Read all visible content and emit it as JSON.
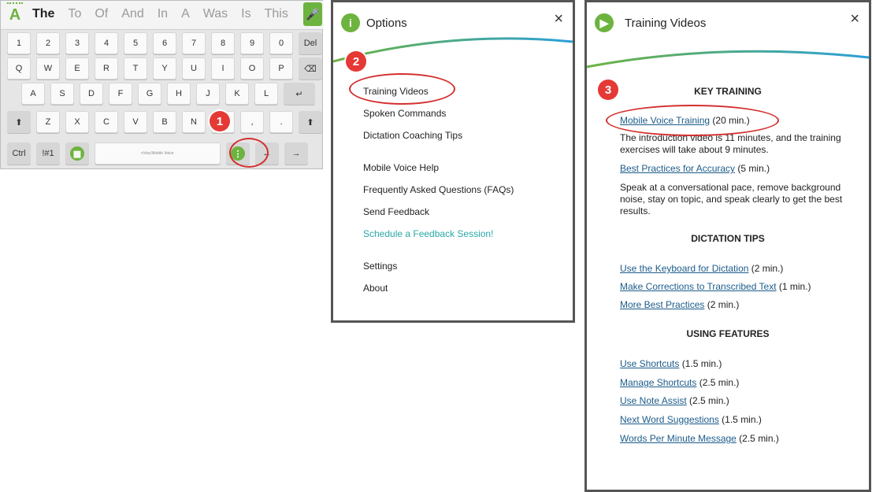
{
  "keyboard": {
    "suggestions": [
      "The",
      "To",
      "Of",
      "And",
      "In",
      "A",
      "Was",
      "Is",
      "This"
    ],
    "numbers": [
      "1",
      "2",
      "3",
      "4",
      "5",
      "6",
      "7",
      "8",
      "9",
      "0",
      "Del"
    ],
    "row_q": [
      "Q",
      "W",
      "E",
      "R",
      "T",
      "Y",
      "U",
      "I",
      "O",
      "P"
    ],
    "row_a": [
      "A",
      "S",
      "D",
      "F",
      "G",
      "H",
      "J",
      "K",
      "L"
    ],
    "row_z": [
      "Z",
      "X",
      "C",
      "V",
      "B",
      "N"
    ],
    "ctrl": "Ctrl",
    "sym": "!#1",
    "space_label": "nVoq Mobile Voice"
  },
  "options": {
    "title": "Options",
    "items": [
      "Training Videos",
      "Spoken Commands",
      "Dictation Coaching Tips"
    ],
    "items2": [
      "Mobile Voice Help",
      "Frequently Asked Questions (FAQs)",
      "Send Feedback"
    ],
    "schedule": "Schedule a Feedback Session!",
    "items3": [
      "Settings",
      "About"
    ]
  },
  "training": {
    "title": "Training Videos",
    "sec1": "KEY TRAINING",
    "mvt_link": "Mobile Voice Training",
    "mvt_time": " (20 min.)",
    "mvt_desc": "The introduction video is 11 minutes, and the training exercises will take about 9 minutes.",
    "bpa_link": "Best Practices for Accuracy",
    "bpa_time": " (5 min.)",
    "bpa_desc": "Speak at a conversational pace, remove background noise, stay on topic, and speak clearly to get the best results.",
    "sec2": "DICTATION TIPS",
    "d1_link": "Use the Keyboard for Dictation",
    "d1_time": " (2 min.)",
    "d2_link": "Make Corrections to Transcribed Text",
    "d2_time": " (1 min.)",
    "d3_link": "More Best Practices",
    "d3_time": " (2 min.)",
    "sec3": "USING FEATURES",
    "f1_link": "Use Shortcuts",
    "f1_time": " (1.5 min.)",
    "f2_link": "Manage Shortcuts",
    "f2_time": " (2.5 min.)",
    "f3_link": "Use Note Assist",
    "f3_time": " (2.5 min.)",
    "f4_link": "Next Word Suggestions",
    "f4_time": " (1.5 min.)",
    "f5_link": "Words Per Minute Message",
    "f5_time": " (2.5 min.)"
  },
  "badges": [
    "1",
    "2",
    "3"
  ],
  "close_glyph": "×"
}
